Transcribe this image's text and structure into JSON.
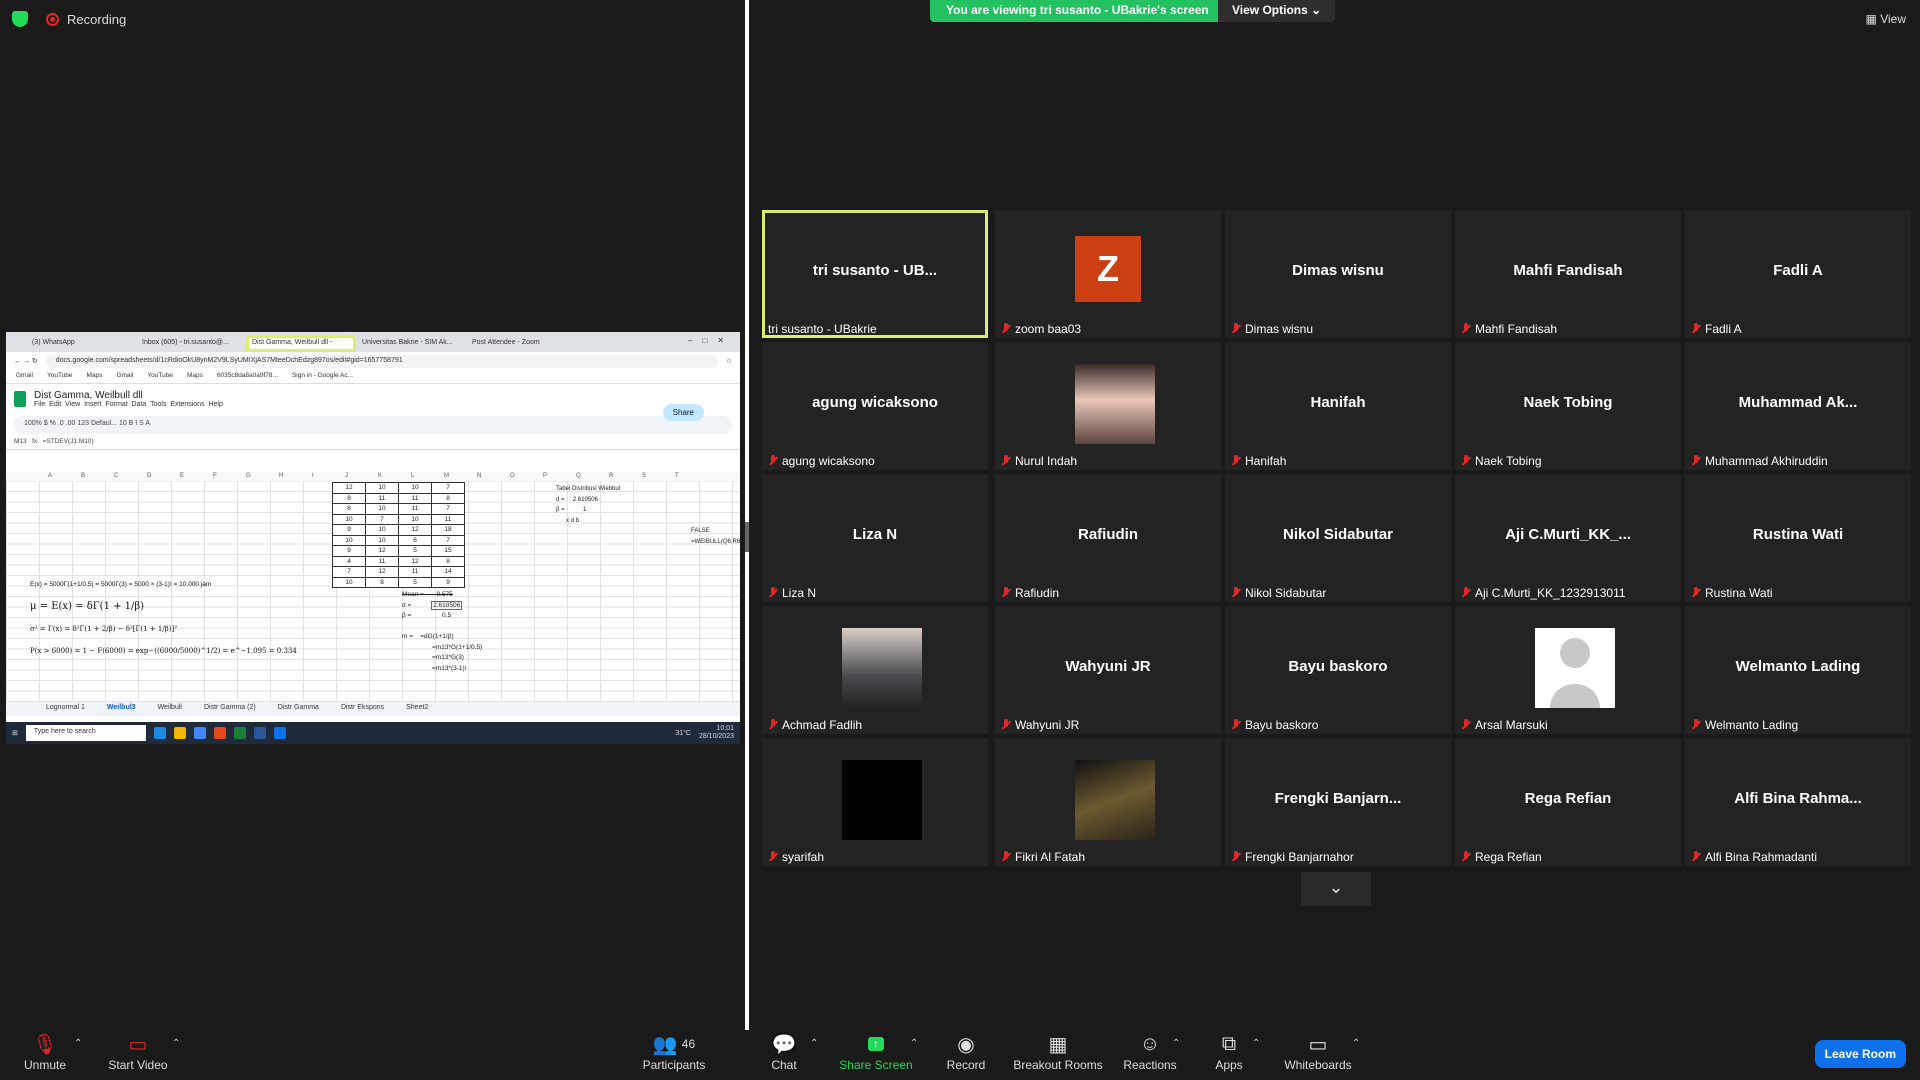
{
  "top": {
    "recording": "Recording",
    "viewing_banner": "You are viewing tri susanto - UBakrie's screen",
    "view_options": "View Options",
    "view": "View"
  },
  "shared_screen": {
    "tabs": [
      "(3) WhatsApp",
      "Inbox (605) - tri.susanto@...",
      "Dist Gamma, Weilbull dll -",
      "Universitas Bakrie - SIM Ak...",
      "Post Attendee - Zoom"
    ],
    "url": "docs.google.com/spreadsheets/d/1cRdioOkU8ynM2V9LSyUMIXjAS7MteeDchEdzg897os/edit#gid=1657758791",
    "bookmarks": [
      "Gmail",
      "YouTube",
      "Maps",
      "Gmail",
      "YouTube",
      "Maps",
      "6035c8da8a0a9f78...",
      "Sign in - Google Ac..."
    ],
    "doc_title": "Dist Gamma, Weilbull dll",
    "menu": [
      "File",
      "Edit",
      "View",
      "Insert",
      "Format",
      "Data",
      "Tools",
      "Extensions",
      "Help"
    ],
    "share": "Share",
    "toolbar": "100%   $   %   .0   .00   123   Defaul...   10   B   I   S   A",
    "cell_ref": "M13",
    "formula": "=STDEV(J1:M10)",
    "columns": [
      "A",
      "B",
      "C",
      "D",
      "E",
      "F",
      "G",
      "H",
      "I",
      "J",
      "K",
      "L",
      "M",
      "N",
      "O",
      "P",
      "Q",
      "R",
      "S",
      "T"
    ],
    "table": [
      [
        "12",
        "10",
        "10",
        "7"
      ],
      [
        "8",
        "11",
        "11",
        "8"
      ],
      [
        "8",
        "10",
        "11",
        "7"
      ],
      [
        "10",
        "7",
        "10",
        "11"
      ],
      [
        "9",
        "10",
        "12",
        "18"
      ],
      [
        "10",
        "10",
        "6",
        "7"
      ],
      [
        "9",
        "12",
        "5",
        "15"
      ],
      [
        "4",
        "11",
        "12",
        "8"
      ],
      [
        "7",
        "12",
        "11",
        "14"
      ],
      [
        "10",
        "8",
        "5",
        "9"
      ]
    ],
    "weibull_title": "Tabel Distribusi Wiebbul",
    "weibull_d": "d =",
    "weibull_d_val": "2.610506",
    "weibull_b": "β =",
    "weibull_b_val": "1",
    "weibull_cols": "x      d      b",
    "weibull_false": "FALSE",
    "weibull_formula": "=WEIBULL(Q6;R6;S6;FALS",
    "formula_lines": [
      "E(x) = 5000Γ(1+1/0.5) = 5000Γ(3) = 5000 × (3-1)! = 10.000 jam",
      "μ = E(x) = δΓ(1 + 1/β)",
      "σ² = Γ(x) = δ²Γ(1 + 2/β) − δ²[Γ(1 + 1/β)]²",
      "P(x > 6000) = 1 − F(6000) = exp−((6000/5000)^1/2) = e^−1.095 = 0.334"
    ],
    "mean_label": "Mean =",
    "mean_val": "9.575",
    "d_label": "d =",
    "d_val": "2.610506",
    "b_label": "β =",
    "b_val": "0.5",
    "m_label": "m =",
    "m_lines": [
      "=dG(1+1/β)",
      "=m13*G(1+1/0.5)",
      "=m13*G(3)",
      "=m13*(3-1)!"
    ],
    "sheet_tabs": [
      "Lognormal 1",
      "Weilbul3",
      "Weilbull",
      "Distr Gamma (2)",
      "Distr Gamma",
      "Distr Ekspons",
      "Sheet2"
    ],
    "taskbar_search": "Type here to search",
    "taskbar_temp": "31°C",
    "taskbar_time": "10:01",
    "taskbar_date": "28/10/2023"
  },
  "participants": [
    {
      "display": "tri susanto - UB...",
      "label": "tri susanto - UBakrie",
      "muted": false,
      "active": true
    },
    {
      "display": "",
      "label": "zoom baa03",
      "muted": true,
      "avatar": "Z"
    },
    {
      "display": "Dimas wisnu",
      "label": "Dimas wisnu",
      "muted": true
    },
    {
      "display": "Mahfi Fandisah",
      "label": "Mahfi Fandisah",
      "muted": true
    },
    {
      "display": "Fadli A",
      "label": "Fadli A",
      "muted": true
    },
    {
      "display": "agung wicaksono",
      "label": "agung wicaksono",
      "muted": true
    },
    {
      "display": "",
      "label": "Nurul Indah",
      "muted": true,
      "photo": "photo1"
    },
    {
      "display": "Hanifah",
      "label": "Hanifah",
      "muted": true
    },
    {
      "display": "Naek Tobing",
      "label": "Naek Tobing",
      "muted": true
    },
    {
      "display": "Muhammad  Ak...",
      "label": "Muhammad Akhiruddin",
      "muted": true
    },
    {
      "display": "Liza N",
      "label": "Liza N",
      "muted": true
    },
    {
      "display": "Rafiudin",
      "label": "Rafiudin",
      "muted": true
    },
    {
      "display": "Nikol Sidabutar",
      "label": "Nikol Sidabutar",
      "muted": true
    },
    {
      "display": "Aji  C.Murti_KK_...",
      "label": "Aji C.Murti_KK_1232913011",
      "muted": true
    },
    {
      "display": "Rustina Wati",
      "label": "Rustina Wati",
      "muted": true
    },
    {
      "display": "",
      "label": "Achmad Fadlih",
      "muted": true,
      "photo": "photo2"
    },
    {
      "display": "Wahyuni JR",
      "label": "Wahyuni JR",
      "muted": true
    },
    {
      "display": "Bayu baskoro",
      "label": "Bayu baskoro",
      "muted": true
    },
    {
      "display": "",
      "label": "Arsal Marsuki",
      "muted": true,
      "photo": "photo3"
    },
    {
      "display": "Welmanto Lading",
      "label": "Welmanto Lading",
      "muted": true
    },
    {
      "display": "",
      "label": "syarifah",
      "muted": true,
      "photo": "photo4"
    },
    {
      "display": "",
      "label": "Fikri Al Fatah",
      "muted": true,
      "photo": "photo5"
    },
    {
      "display": "Frengki  Banjarn...",
      "label": "Frengki Banjarnahor",
      "muted": true
    },
    {
      "display": "Rega Refian",
      "label": "Rega Refian",
      "muted": true
    },
    {
      "display": "Alfi Bina Rahma...",
      "label": "Alfi Bina Rahmadanti",
      "muted": true
    }
  ],
  "bottom": {
    "unmute": "Unmute",
    "start_video": "Start Video",
    "participants": "Participants",
    "participants_count": "46",
    "chat": "Chat",
    "share_screen": "Share Screen",
    "record": "Record",
    "breakout_rooms": "Breakout Rooms",
    "reactions": "Reactions",
    "apps": "Apps",
    "whiteboards": "Whiteboards",
    "leave_room": "Leave Room"
  }
}
